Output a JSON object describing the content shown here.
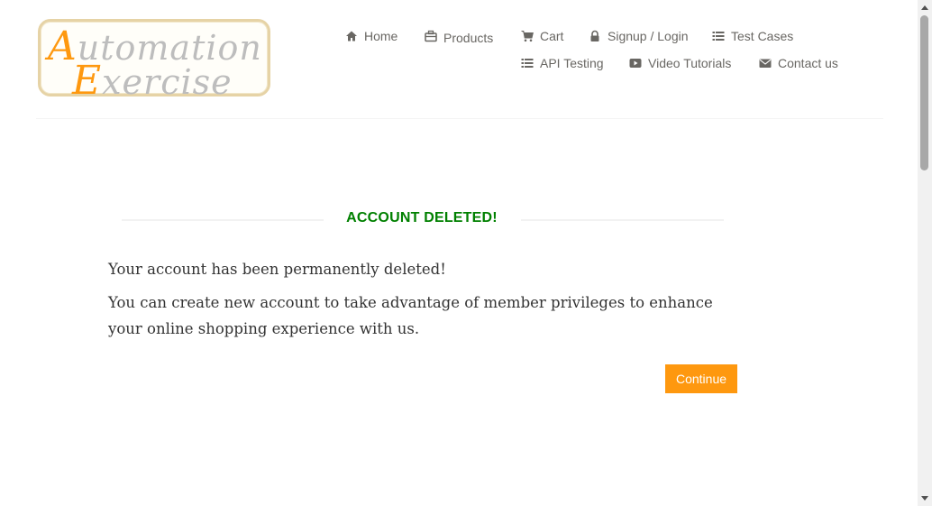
{
  "logo": {
    "line1_accent": "A",
    "line1_rest": "utomation",
    "line2_accent": "E",
    "line2_rest": "xercise"
  },
  "nav": {
    "home": "Home",
    "products": "Products",
    "cart": "Cart",
    "signup_login": "Signup / Login",
    "test_cases": "Test Cases",
    "api_testing": "API Testing",
    "video_tutorials": "Video Tutorials",
    "contact_us": "Contact us"
  },
  "main": {
    "title": "ACCOUNT DELETED!",
    "message1": "Your account has been permanently deleted!",
    "message2": "You can create new account to take advantage of member privileges to enhance your online shopping experience with us.",
    "continue_label": "Continue"
  },
  "colors": {
    "accent": "#fe980f",
    "success": "#008000",
    "nav_text": "#696763"
  },
  "icons": {
    "home": "home-icon",
    "products": "briefcase-icon",
    "cart": "shopping-cart-icon",
    "signup_login": "lock-icon",
    "test_cases": "list-icon",
    "api_testing": "list-icon",
    "video_tutorials": "youtube-play-icon",
    "contact_us": "envelope-icon"
  }
}
